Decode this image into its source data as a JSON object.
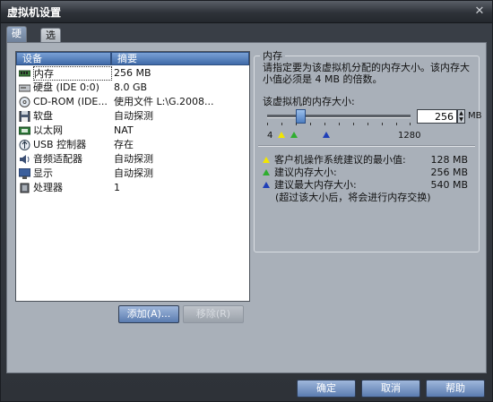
{
  "window": {
    "title": "虚拟机设置",
    "close_icon": "close-icon"
  },
  "tabs": [
    {
      "label": "硬件",
      "active": true
    },
    {
      "label": "选项",
      "active": false
    }
  ],
  "devices": {
    "columns": [
      "设备",
      "摘要"
    ],
    "rows": [
      {
        "icon": "memory-icon",
        "name": "内存",
        "summary": "256 MB",
        "selected": true
      },
      {
        "icon": "harddisk-icon",
        "name": "硬盘 (IDE 0:0)",
        "summary": "8.0 GB"
      },
      {
        "icon": "cdrom-icon",
        "name": "CD-ROM (IDE...",
        "summary": "使用文件 L:\\G.2008..."
      },
      {
        "icon": "floppy-icon",
        "name": "软盘",
        "summary": "自动探测"
      },
      {
        "icon": "network-icon",
        "name": "以太网",
        "summary": "NAT"
      },
      {
        "icon": "usb-icon",
        "name": "USB 控制器",
        "summary": "存在"
      },
      {
        "icon": "sound-icon",
        "name": "音频适配器",
        "summary": "自动探测"
      },
      {
        "icon": "display-icon",
        "name": "显示",
        "summary": "自动探测"
      },
      {
        "icon": "cpu-icon",
        "name": "处理器",
        "summary": "1"
      }
    ],
    "add_label": "添加(A)...",
    "remove_label": "移除(R)"
  },
  "memory": {
    "group_title": "内存",
    "description_line1": "请指定要为该虚拟机分配的内存大小。该内存大",
    "description_line2": "小值必须是 4 MB 的倍数。",
    "size_label": "该虚拟机的内存大小:",
    "value": "256",
    "unit": "MB",
    "slider_min": "4",
    "slider_max": "1280",
    "slider_value_mb": 256,
    "info": [
      {
        "color": "#f2e600",
        "label": "客户机操作系统建议的最小值:",
        "value": "128 MB"
      },
      {
        "color": "#2fae2f",
        "label": "建议内存大小:",
        "value": "256 MB"
      },
      {
        "color": "#1f3fb8",
        "label": "建议最大内存大小:",
        "value": "540 MB"
      }
    ],
    "note": "(超过该大小后，将会进行内存交换)"
  },
  "buttons": {
    "ok": "确定",
    "cancel": "取消",
    "help": "帮助"
  }
}
